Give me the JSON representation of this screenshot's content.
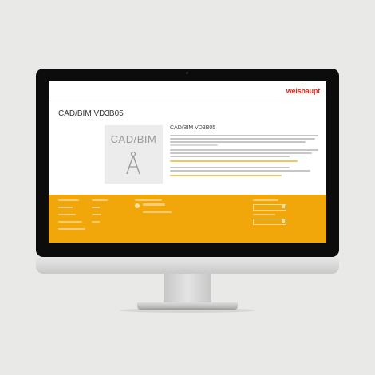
{
  "website": {
    "logo": "weishaupt",
    "page_title": "CAD/BIM VD3B05",
    "preview_label": "CAD/BIM",
    "preview_icon": "drafting-compass-icon",
    "info_title": "CAD/BIM VD3B05"
  },
  "colors": {
    "brand_red": "#e3271c",
    "footer_orange": "#f1a70a",
    "background": "#e9e9e7",
    "bezel": "#0c0c0c"
  }
}
